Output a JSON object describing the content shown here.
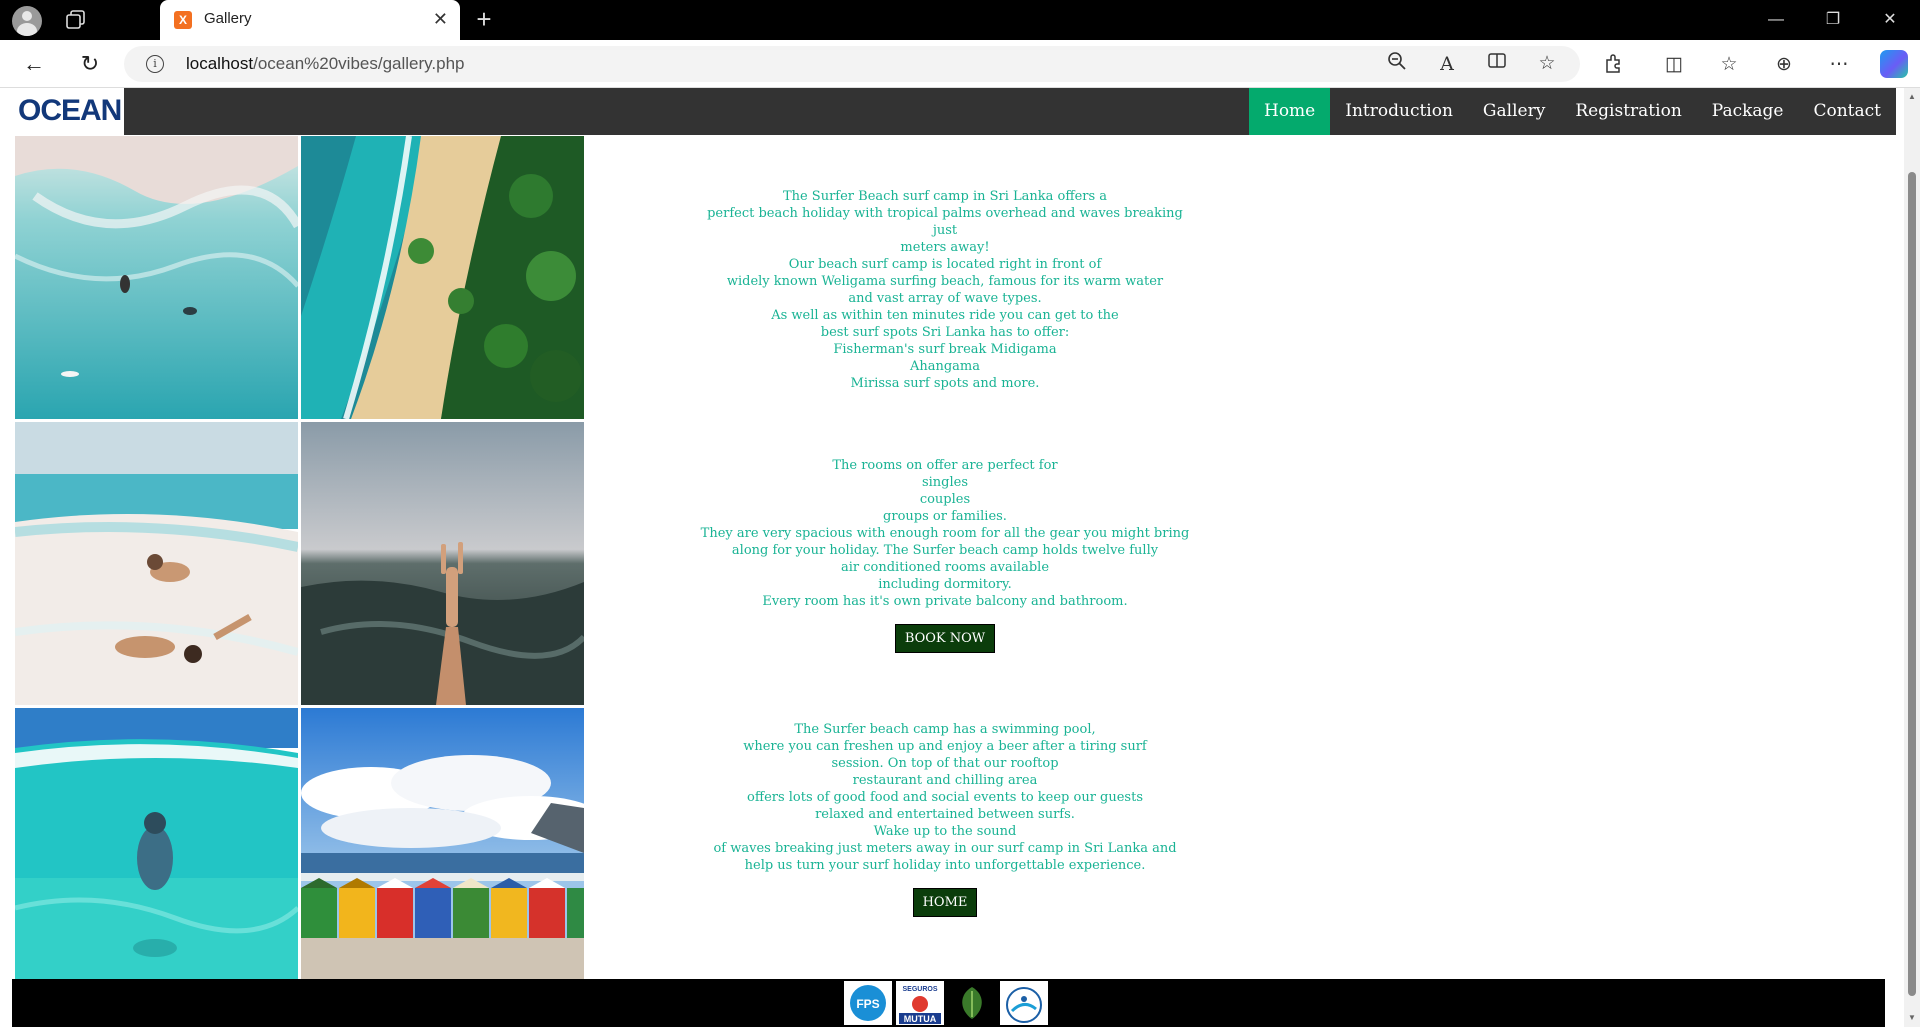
{
  "browser": {
    "tab_title": "Gallery",
    "tab_favicon": "X",
    "tab_close_glyph": "✕",
    "new_tab_glyph": "+",
    "url_host": "localhost",
    "url_path": "/ocean%20vibes/gallery.php",
    "window_controls": {
      "minimize": "—",
      "maximize": "❐",
      "close": "✕"
    },
    "nav": {
      "back": "←",
      "refresh": "↻",
      "info": "i"
    },
    "tools": {
      "zoom": "🔍",
      "read_aloud": "A",
      "immersive": "📖",
      "favorite": "☆",
      "extensions": "⧉",
      "split": "◫",
      "favorites": "☆",
      "collections": "⊕",
      "more": "⋯"
    }
  },
  "site": {
    "logo_text": "OCEAN",
    "nav": [
      {
        "label": "Home",
        "active": true
      },
      {
        "label": "Introduction",
        "active": false
      },
      {
        "label": "Gallery",
        "active": false
      },
      {
        "label": "Registration",
        "active": false
      },
      {
        "label": "Package",
        "active": false
      },
      {
        "label": "Contact",
        "active": false
      }
    ],
    "gallery": [
      {
        "alt": "aerial surf water"
      },
      {
        "alt": "aerial beach with palms"
      },
      {
        "alt": "girls lying in surf"
      },
      {
        "alt": "hand sign in ocean"
      },
      {
        "alt": "underwater snorkeler"
      },
      {
        "alt": "colorful beach huts"
      }
    ],
    "section1": {
      "lines": [
        "The Surfer Beach surf camp in Sri Lanka offers a",
        "perfect beach holiday with tropical palms overhead and waves breaking just",
        "meters away!",
        "Our beach surf camp is located right in front of",
        "widely known Weligama surfing beach, famous for its warm water",
        "and vast array of wave types.",
        "As well as within ten minutes ride you can get to the",
        "best surf spots Sri Lanka has to offer:",
        "Fisherman's surf break Midigama",
        "Ahangama",
        "Mirissa surf spots and more."
      ]
    },
    "section2": {
      "lines": [
        "The rooms on offer are perfect for",
        "singles",
        "couples",
        "groups or families.",
        "They are very spacious with enough room for all the gear you might bring",
        "along for your holiday. The Surfer beach camp holds twelve fully",
        "air conditioned rooms available",
        "including dormitory.",
        "Every room has it's own private balcony and bathroom."
      ],
      "button": "BOOK NOW"
    },
    "section3": {
      "lines": [
        "The Surfer beach camp has a swimming pool,",
        "where you can freshen up and enjoy a beer after a tiring surf",
        "session. On top of that our rooftop",
        "restaurant and chilling area",
        "offers lots of good food and social events to keep our guests",
        "relaxed and entertained between surfs.",
        "Wake up to the sound",
        "of waves breaking just meters away in our surf camp in Sri Lanka and",
        "help us turn your surf holiday into unforgettable experience."
      ],
      "button": "HOME"
    },
    "footer_logos": [
      {
        "label": "FPS"
      },
      {
        "label": "SEGUROS",
        "sub": "MUTUA"
      },
      {
        "label": "eco logo"
      },
      {
        "label": "surf logo"
      }
    ]
  },
  "colors": {
    "nav_bg": "#333333",
    "nav_active": "#04aa6d",
    "text_accent": "#19b394",
    "button_bg": "#0b3d0b",
    "footer_bg": "#000000"
  }
}
